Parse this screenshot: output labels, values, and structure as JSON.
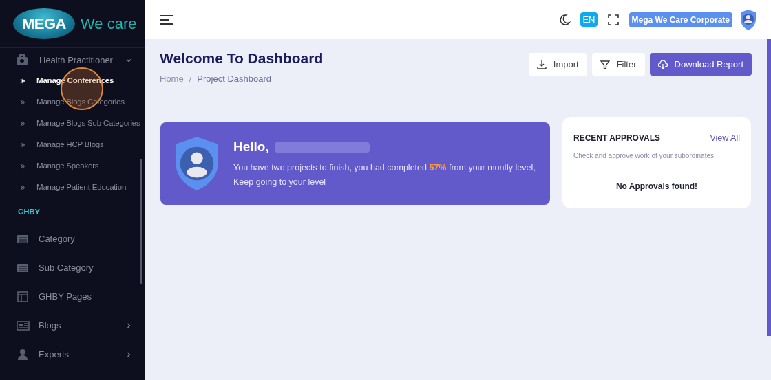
{
  "sidebar": {
    "logo": {
      "badge": "MEGA",
      "text": "We care"
    },
    "groups": [
      {
        "label": "Health Practitioner",
        "kind": "medkit",
        "expanded": true,
        "children": [
          {
            "label": "Manage Conferences",
            "selected": true
          },
          {
            "label": "Manage Blogs Categories",
            "selected": false
          },
          {
            "label": "Manage Blogs Sub Categories",
            "selected": false
          },
          {
            "label": "Manage HCP Blogs",
            "selected": false
          },
          {
            "label": "Manage Speakers",
            "selected": false
          },
          {
            "label": "Manage Patient Education",
            "selected": false
          }
        ]
      }
    ],
    "section": "GHBY",
    "items": [
      {
        "label": "Category",
        "kind": "list",
        "expandable": false
      },
      {
        "label": "Sub Category",
        "kind": "list",
        "expandable": false
      },
      {
        "label": "GHBY Pages",
        "kind": "layout",
        "expandable": false
      },
      {
        "label": "Blogs",
        "kind": "news",
        "expandable": true
      },
      {
        "label": "Experts",
        "kind": "person",
        "expandable": true
      }
    ]
  },
  "header": {
    "language": "EN",
    "account": "Mega We Care Corporate"
  },
  "page": {
    "title": "Welcome To Dashboard",
    "breadcrumb": [
      "Home",
      "Project Dashboard"
    ],
    "breadcrumb_separator": "/",
    "buttons": [
      {
        "label": "Import",
        "kind": "import"
      },
      {
        "label": "Filter",
        "kind": "filter"
      },
      {
        "label": "Download Report",
        "kind": "download"
      }
    ]
  },
  "welcome": {
    "greeting": "Hello,",
    "message": "You have two projects to finish, you had completed **57%** from your montly level, Keep going to your level"
  },
  "approvals": {
    "title": "RECENT APPROVALS",
    "link": "View All",
    "subtitle": "Check and approve work of your subordinates.",
    "empty": "No Approvals found!"
  }
}
